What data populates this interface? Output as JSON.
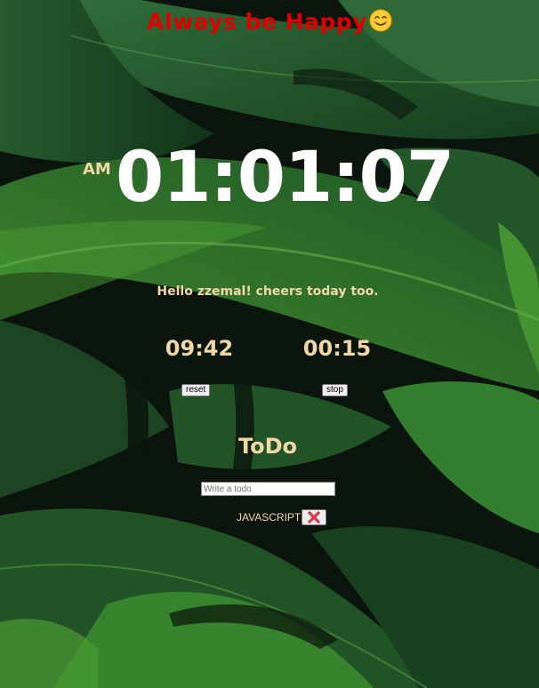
{
  "header": {
    "title": "Always be Happy",
    "emoji_icon": "smiling-face-icon"
  },
  "clock": {
    "period": "AM",
    "time": "01:01:07"
  },
  "greeting": {
    "text": "Hello zzemal! cheers today too."
  },
  "timers": [
    {
      "value": "09:42",
      "button_label": "reset"
    },
    {
      "value": "00:15",
      "button_label": "stop"
    }
  ],
  "todo": {
    "title": "ToDo",
    "input_placeholder": "Write a todo",
    "input_value": "",
    "items": [
      {
        "text": "JAVASCRIPT",
        "delete_icon": "red-x-icon"
      }
    ]
  },
  "colors": {
    "title": "#e00000",
    "accent_text": "#f2d7a6",
    "clock_text": "#ffffff",
    "background": "#0f1f13"
  }
}
